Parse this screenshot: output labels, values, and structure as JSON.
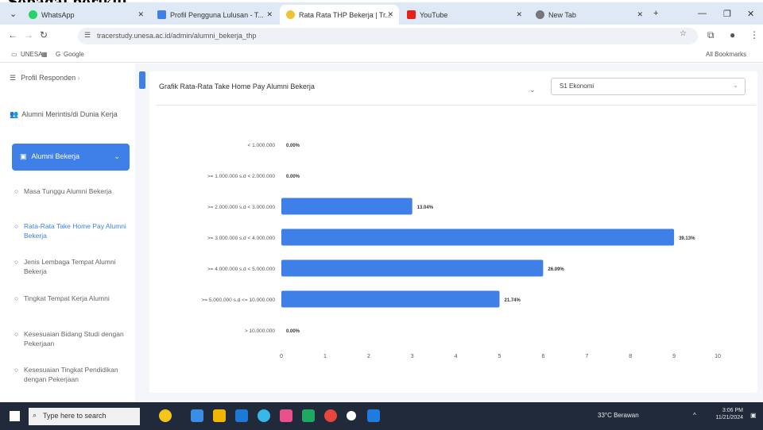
{
  "overlay_text": "Sebagai berikut",
  "browser": {
    "tabs": [
      {
        "label": "WhatsApp",
        "color": "#25d366",
        "active": false
      },
      {
        "label": "Profil Pengguna Lulusan - T...",
        "color": "#3f7fe8",
        "active": false
      },
      {
        "label": "Rata Rata THP Bekerja | Tr...",
        "color": "#f2c230",
        "active": true
      },
      {
        "label": "YouTube",
        "color": "#e62117",
        "active": false
      },
      {
        "label": "New Tab",
        "color": "#777777",
        "active": false
      }
    ],
    "url": "tracerstudy.unesa.ac.id/admin/alumni_bekerja_thp",
    "bookmarks": [
      "UNESA",
      "Google"
    ],
    "all_bookmarks": "All Bookmarks"
  },
  "sidebar": {
    "items": [
      "Profil Responden",
      "Alumni Merintis/di Dunia Kerja"
    ],
    "active": "Alumni Bekerja",
    "subitems": [
      {
        "label": "Masa Tunggu Alumni Bekerja",
        "selected": false
      },
      {
        "label": "Rata-Rata Take Home Pay Alumni Bekerja",
        "selected": true
      },
      {
        "label": "Jenis Lembaga Tempat Alumni Bekerja",
        "selected": false
      },
      {
        "label": "Tingkat Tempat Kerja Alumni",
        "selected": false
      },
      {
        "label": "Kesesuaian Bidang Studi dengan Pekerjaan",
        "selected": false
      },
      {
        "label": "Kesesuaian Tingkat Pendidikan dengan Pekerjaan",
        "selected": false
      }
    ]
  },
  "card": {
    "title": "Grafik Rata-Rata Take Home Pay Alumni Bekerja",
    "select_value": "S1 Ekonomi"
  },
  "chart_data": {
    "type": "bar",
    "orientation": "horizontal",
    "categories": [
      "< 1.000.000",
      ">= 1.000.000 s.d < 2.000.000",
      ">= 2.000.000 s.d < 3.000.000",
      ">= 3.000.000 s.d < 4.000.000",
      ">= 4.000.000 s.d < 5.000.000",
      ">= 5.000.000 s.d <= 10.000.000",
      "> 10.000.000"
    ],
    "values": [
      0,
      0,
      3,
      9,
      6,
      5,
      0
    ],
    "labels": [
      "0.00%",
      "0.00%",
      "13.04%",
      "39.13%",
      "26.09%",
      "21.74%",
      "0.00%"
    ],
    "xticks": [
      0,
      1,
      2,
      3,
      4,
      5,
      6,
      7,
      8,
      9,
      10
    ],
    "xlim": [
      0,
      10
    ],
    "color": "#3f7fe8",
    "grid": false
  },
  "taskbar": {
    "search_placeholder": "Type here to search",
    "weather": "33°C Berawan",
    "time": "3:06 PM",
    "date": "11/21/2024"
  }
}
